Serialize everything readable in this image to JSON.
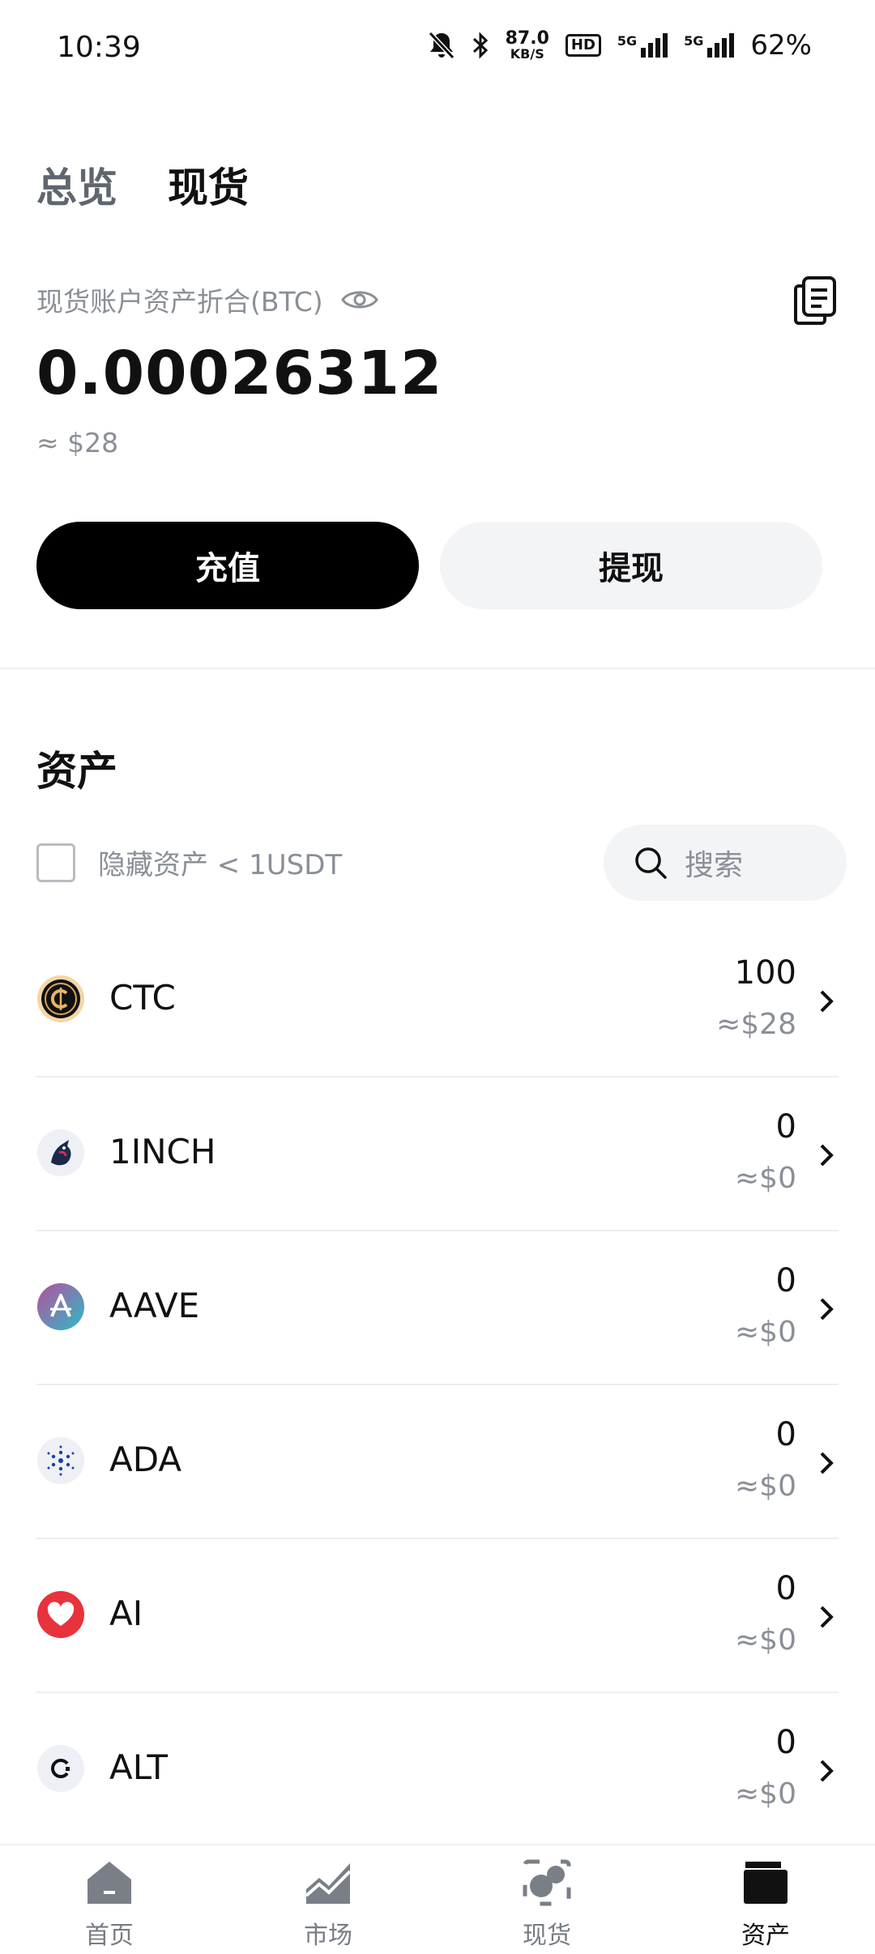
{
  "status_bar": {
    "time": "10:39",
    "net_speed_value": "87.0",
    "net_speed_unit": "KB/S",
    "hd_badge": "HD",
    "signal1_label": "5G",
    "signal2_label": "5G",
    "battery": "62%"
  },
  "tabs": [
    {
      "label": "总览",
      "active": false
    },
    {
      "label": "现货",
      "active": true
    }
  ],
  "account": {
    "label": "现货账户资产折合(BTC)",
    "balance": "0.00026312",
    "balance_usd": "≈ $28"
  },
  "actions": {
    "deposit_label": "充值",
    "withdraw_label": "提现"
  },
  "assets": {
    "title": "资产",
    "hide_small_label": "隐藏资产 < 1USDT",
    "search_placeholder": "搜索",
    "items": [
      {
        "symbol": "CTC",
        "amount": "100",
        "usd": "≈$28",
        "icon": "ctc-coin-icon"
      },
      {
        "symbol": "1INCH",
        "amount": "0",
        "usd": "≈$0",
        "icon": "1inch-coin-icon"
      },
      {
        "symbol": "AAVE",
        "amount": "0",
        "usd": "≈$0",
        "icon": "aave-coin-icon"
      },
      {
        "symbol": "ADA",
        "amount": "0",
        "usd": "≈$0",
        "icon": "ada-coin-icon"
      },
      {
        "symbol": "AI",
        "amount": "0",
        "usd": "≈$0",
        "icon": "ai-coin-icon"
      },
      {
        "symbol": "ALT",
        "amount": "0",
        "usd": "≈$0",
        "icon": "alt-coin-icon"
      }
    ]
  },
  "bottom_nav": [
    {
      "label": "首页",
      "icon": "home-icon",
      "active": false
    },
    {
      "label": "市场",
      "icon": "market-chart-icon",
      "active": false
    },
    {
      "label": "现货",
      "icon": "spot-trade-icon",
      "active": false
    },
    {
      "label": "资产",
      "icon": "wallet-icon",
      "active": true
    }
  ],
  "colors": {
    "primary": "#000000",
    "muted_text": "#8a8f97",
    "secondary_bg": "#f3f4f6"
  }
}
